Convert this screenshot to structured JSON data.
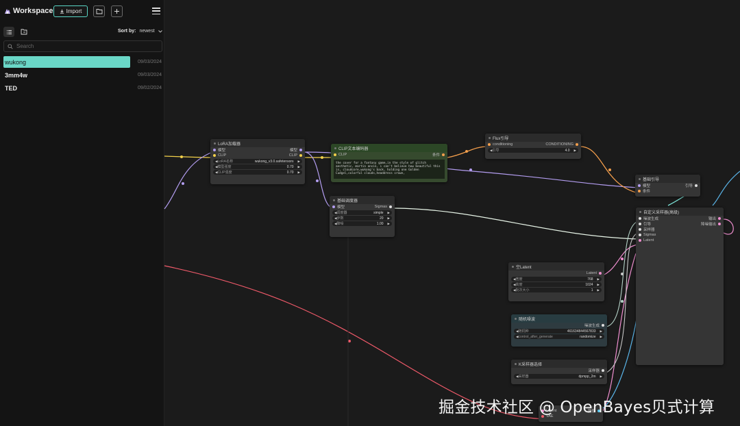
{
  "app": {
    "title": "Workspace"
  },
  "toolbar": {
    "import_label": "Import"
  },
  "list_header": {
    "sort_label": "Sort by:",
    "sort_value": "newest"
  },
  "search": {
    "placeholder": "Search"
  },
  "workflows": [
    {
      "name": "wukong",
      "date": "09/03/2024",
      "active": true
    },
    {
      "name": "3mm4w",
      "date": "09/03/2024",
      "active": false
    },
    {
      "name": "TED",
      "date": "09/02/2024",
      "active": false
    }
  ],
  "nodes": {
    "lora": {
      "title": "LoRA加载器",
      "in_model": "模型",
      "in_clip": "CLIP",
      "out_model": "模型",
      "out_clip": "CLIP",
      "w1_label": "LoRA名称",
      "w1_value": "wukong_v3.0.safetensors",
      "w2_label": "模型强度",
      "w2_value": "0.70",
      "w3_label": "CLIP强度",
      "w3_value": "0.70"
    },
    "clip_text": {
      "title": "CLIP文本编码器",
      "in_clip": "CLIP",
      "out": "条件",
      "prompt": "the cover for a fantasy game,in the style of glitch aesthetic, martin ansin, i can't believe how beautiful this is, cloudcore,wukong's back, holding one Golden Cudgel,colorful clouds,headdress crown,"
    },
    "flux": {
      "title": "Flux引导",
      "in": "conditioning",
      "out": "CONDITIONING",
      "w1_label": "引导",
      "w1_value": "4.0"
    },
    "scheduler": {
      "title": "基础调度器",
      "in": "模型",
      "out": "Sigmas",
      "w1_label": "调度器",
      "w1_value": "simple",
      "w2_label": "步数",
      "w2_value": "20",
      "w3_label": "降噪",
      "w3_value": "1.00"
    },
    "guider": {
      "title": "基础引导",
      "in1": "模型",
      "in2": "条件",
      "out": "引导"
    },
    "custom_sampler": {
      "title": "自定义采样器(高级)",
      "in1": "噪波生成",
      "in2": "引导",
      "in3": "采样器",
      "in4": "Sigmas",
      "in5": "Latent",
      "out1": "输出",
      "out2": "降噪输出"
    },
    "empty_latent": {
      "title": "空Latent",
      "out": "Latent",
      "w1_label": "宽度",
      "w1_value": "768",
      "w2_label": "高度",
      "w2_value": "1024",
      "w3_label": "批次大小",
      "w3_value": "1"
    },
    "random_noise": {
      "title": "随机噪波",
      "out": "噪波生成",
      "w1_label": "随机种",
      "w1_value": "461634844567833",
      "w2_label": "control_after_generate",
      "w2_value": "randomize"
    },
    "ksampler_select": {
      "title": "K采样器选择",
      "out": "采样器",
      "w1_label": "采样器",
      "w1_value": "dpmpp_2m"
    },
    "vae_decode": {
      "in1": "Latent",
      "in2": "VAE",
      "out": "图像"
    }
  },
  "colors": {
    "accent": "#6ad7c7",
    "clip": "#f2d04a",
    "model": "#b39df0",
    "conditioning": "#f59f4c",
    "sigmas": "#ffffff",
    "latent": "#f08fd0",
    "vae": "#f05a6a",
    "noise": "#9fe0c8"
  },
  "watermark": "掘金技术社区 @ OpenBayes贝式计算"
}
